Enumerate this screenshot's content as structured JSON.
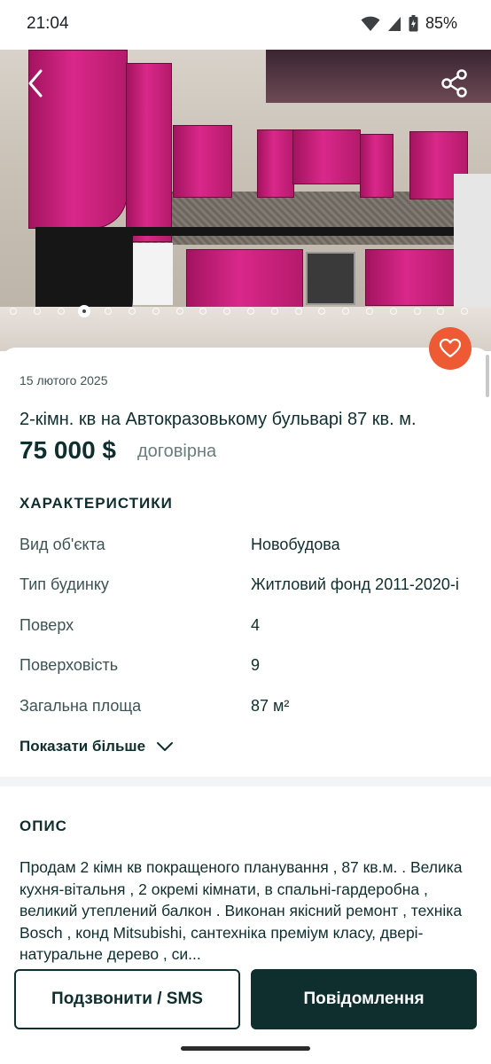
{
  "status_bar": {
    "time": "21:04",
    "battery": "85%"
  },
  "gallery": {
    "photo_count": 20,
    "active_index": 3
  },
  "listing": {
    "date": "15 лютого 2025",
    "title": "2-кімн. кв на Автокразовькому бульварі 87 кв. м.",
    "price": "75 000 $",
    "price_note": "договірна"
  },
  "characteristics": {
    "heading": "ХАРАКТЕРИСТИКИ",
    "rows": [
      {
        "key": "Вид об'єкта",
        "value": "Новобудова"
      },
      {
        "key": "Тип будинку",
        "value": "Житловий фонд 2011-2020-і"
      },
      {
        "key": "Поверх",
        "value": "4"
      },
      {
        "key": "Поверховість",
        "value": "9"
      },
      {
        "key": "Загальна площа",
        "value": "87 м²"
      }
    ],
    "show_more": "Показати більше"
  },
  "description": {
    "heading": "ОПИС",
    "text": "Продам 2 кімн кв покращеного планування , 87 кв.м. . Велика кухня-вітальня , 2 окремі кімнати, в спальні-гардеробна , великий утеплений балкон . Виконан якісний ремонт , техніка Bosch , конд Mitsubishi, сантехніка преміум класу, двері-натуральне дерево , си..."
  },
  "actions": {
    "call": "Подзвонити / SMS",
    "message": "Повідомлення"
  },
  "colors": {
    "brand_dark": "#0f2e2e",
    "favorite": "#ed5a33"
  }
}
